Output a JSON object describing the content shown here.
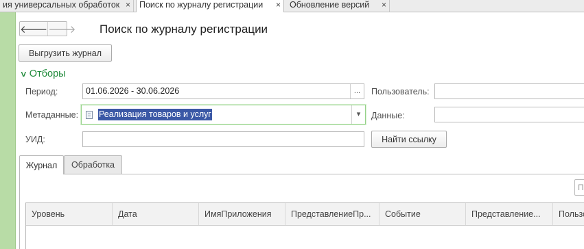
{
  "tabs": [
    {
      "label": "ия универсальных обработок",
      "close": "×"
    },
    {
      "label": "Поиск по журналу регистрации",
      "close": "×"
    },
    {
      "label": "Обновление версий",
      "close": "×"
    }
  ],
  "nav": {
    "back": "🡐",
    "forward": "🡒"
  },
  "form": {
    "title": "Поиск по журналу регистрации",
    "export_button": "Выгрузить журнал"
  },
  "filters": {
    "header": "Отборы",
    "chevron": "∨",
    "period_label": "Период:",
    "period_value": "01.06.2026 - 30.06.2026",
    "period_button": "...",
    "user_label": "Пользователь:",
    "user_value": "",
    "metadata_label": "Метаданные:",
    "metadata_value": "Реализация товаров и услуг",
    "metadata_dropdown": "▾",
    "data_label": "Данные:",
    "data_value": "",
    "uid_label": "УИД:",
    "uid_value": "",
    "find_link_button": "Найти ссылку"
  },
  "page_tabs": [
    {
      "label": "Журнал",
      "active": true
    },
    {
      "label": "Обработка",
      "active": false
    }
  ],
  "search_placeholder": "П",
  "table": {
    "columns": [
      "Уровень",
      "Дата",
      "ИмяПриложения",
      "ПредставлениеПр...",
      "Событие",
      "Представление...",
      "Пользо"
    ]
  },
  "colors": {
    "accent_green": "#1f8a3a",
    "sidebar_green": "#b8dca6",
    "selection_blue": "#3b58a6"
  }
}
